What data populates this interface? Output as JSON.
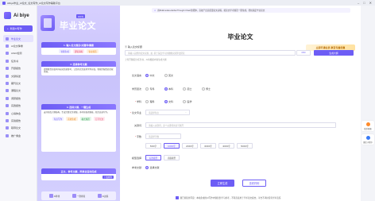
{
  "window": {
    "title": "Aibiye毕业_AI论文_论文写作_AI论文写作辅助平台",
    "min": "–",
    "max": "□",
    "close": "✕"
  },
  "sidebar": {
    "brand": "Ai biye",
    "new_button": "新建AI写作",
    "items": [
      {
        "label": "毕业论文",
        "active": true
      },
      {
        "label": "AI论文降重"
      },
      {
        "label": "AIGC检测"
      },
      {
        "label": "任务书"
      },
      {
        "label": "开题报告"
      },
      {
        "label": "文献综述"
      },
      {
        "label": "期刊论文"
      },
      {
        "label": "课程论文"
      },
      {
        "label": "调研报告"
      },
      {
        "label": "实践报告"
      },
      {
        "label": "心得体会"
      },
      {
        "label": "实验报告"
      },
      {
        "label": "职称论文"
      },
      {
        "label": "推广佣金"
      }
    ]
  },
  "leftpanel": {
    "badge": "AI写作",
    "title": "毕业论文",
    "step1": {
      "header": "1. 输入论文题目/关键词/摘要",
      "chips": [
        "智能生成",
        "逻辑清晰",
        "专业规范"
      ]
    },
    "step2": {
      "header": "2. 选择参考文献",
      "text": "提供数百万篇中外权威文献参考，让您的论文更具学术价值，智能匹配优质文献资源。"
    },
    "step3": {
      "header": "3. 选择大纲，一键生成",
      "text": "支持修改大纲结构，生成完整论文初稿，多样化格式模板，助力高效写作。",
      "chips": [
        "专业写作",
        "高效生成",
        "格式规范",
        "万字长文"
      ]
    },
    "step4": {
      "header": "正文、参考文献、附录全自动完成",
      "button": "下载样例"
    },
    "tools": [
      "AI降重",
      "一键排版",
      "AI改稿"
    ]
  },
  "main": {
    "notice": "用Multimodal+Global Thought Chain智能体，高效产出高质量论文初稿，按论文学术规范一键生成，轻松搞定毕业论文",
    "vip_banner": "立即开通会员 享受专属优惠",
    "page_title": "毕业论文",
    "title_label": "① 输入论文标题",
    "title_placeholder": "请输入完整的论文标题，如: 基于深度学习的图像识别算法研究",
    "title_count": "0/50",
    "outline_button": "生成大纲",
    "hint": "上传开题报告/任务书，AI将根据内容生成大纲",
    "lang_label": "论文语言",
    "lang_options": [
      "中文",
      "英文"
    ],
    "degree_label": "学历层次",
    "degree_options": [
      "专科",
      "本科",
      "硕士",
      "博士"
    ],
    "subject_label": "学科",
    "subject_options": [
      "理科",
      "文科",
      "医学"
    ],
    "major_label": "论文专业",
    "major_placeholder": "请选择专业",
    "keyword_label": "关键词",
    "keyword_placeholder": "请输入关键词，多个关键词用逗号隔开",
    "wordcount_label": "字数",
    "wordcount_placeholder": "请选择字数",
    "wordcount_options": [
      "5000字",
      "10000字",
      "20000字",
      "30000字",
      "40000字",
      "50000字"
    ],
    "model_label": "模型选择",
    "model_options": [
      "标准模型",
      "高级模型"
    ],
    "ref_label": "参考文献",
    "ref_options": [
      "选择文献"
    ],
    "submit": "立即生成",
    "sample": "查看样例",
    "agree_text": "我已阅读并同意：本站生成的AI写作内容仅供学习参考，不得直接用于学术论文提交，平台不承担任何学术责任"
  },
  "floating": [
    {
      "label": "联系客服",
      "icon": "headset-icon"
    },
    {
      "label": "微信小程序",
      "icon": "wechat-icon"
    }
  ],
  "colors": {
    "accent": "#6d5df5",
    "vip": "#b86b00"
  }
}
